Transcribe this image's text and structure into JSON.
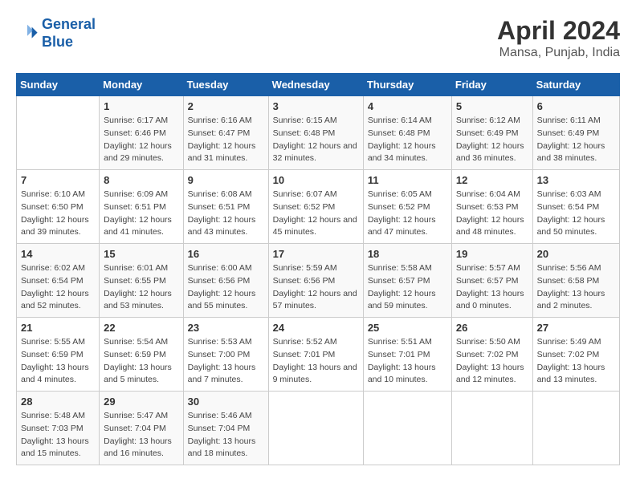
{
  "logo": {
    "line1": "General",
    "line2": "Blue"
  },
  "title": "April 2024",
  "subtitle": "Mansa, Punjab, India",
  "headers": [
    "Sunday",
    "Monday",
    "Tuesday",
    "Wednesday",
    "Thursday",
    "Friday",
    "Saturday"
  ],
  "weeks": [
    [
      {
        "day": "",
        "sunrise": "",
        "sunset": "",
        "daylight": ""
      },
      {
        "day": "1",
        "sunrise": "Sunrise: 6:17 AM",
        "sunset": "Sunset: 6:46 PM",
        "daylight": "Daylight: 12 hours and 29 minutes."
      },
      {
        "day": "2",
        "sunrise": "Sunrise: 6:16 AM",
        "sunset": "Sunset: 6:47 PM",
        "daylight": "Daylight: 12 hours and 31 minutes."
      },
      {
        "day": "3",
        "sunrise": "Sunrise: 6:15 AM",
        "sunset": "Sunset: 6:48 PM",
        "daylight": "Daylight: 12 hours and 32 minutes."
      },
      {
        "day": "4",
        "sunrise": "Sunrise: 6:14 AM",
        "sunset": "Sunset: 6:48 PM",
        "daylight": "Daylight: 12 hours and 34 minutes."
      },
      {
        "day": "5",
        "sunrise": "Sunrise: 6:12 AM",
        "sunset": "Sunset: 6:49 PM",
        "daylight": "Daylight: 12 hours and 36 minutes."
      },
      {
        "day": "6",
        "sunrise": "Sunrise: 6:11 AM",
        "sunset": "Sunset: 6:49 PM",
        "daylight": "Daylight: 12 hours and 38 minutes."
      }
    ],
    [
      {
        "day": "7",
        "sunrise": "Sunrise: 6:10 AM",
        "sunset": "Sunset: 6:50 PM",
        "daylight": "Daylight: 12 hours and 39 minutes."
      },
      {
        "day": "8",
        "sunrise": "Sunrise: 6:09 AM",
        "sunset": "Sunset: 6:51 PM",
        "daylight": "Daylight: 12 hours and 41 minutes."
      },
      {
        "day": "9",
        "sunrise": "Sunrise: 6:08 AM",
        "sunset": "Sunset: 6:51 PM",
        "daylight": "Daylight: 12 hours and 43 minutes."
      },
      {
        "day": "10",
        "sunrise": "Sunrise: 6:07 AM",
        "sunset": "Sunset: 6:52 PM",
        "daylight": "Daylight: 12 hours and 45 minutes."
      },
      {
        "day": "11",
        "sunrise": "Sunrise: 6:05 AM",
        "sunset": "Sunset: 6:52 PM",
        "daylight": "Daylight: 12 hours and 47 minutes."
      },
      {
        "day": "12",
        "sunrise": "Sunrise: 6:04 AM",
        "sunset": "Sunset: 6:53 PM",
        "daylight": "Daylight: 12 hours and 48 minutes."
      },
      {
        "day": "13",
        "sunrise": "Sunrise: 6:03 AM",
        "sunset": "Sunset: 6:54 PM",
        "daylight": "Daylight: 12 hours and 50 minutes."
      }
    ],
    [
      {
        "day": "14",
        "sunrise": "Sunrise: 6:02 AM",
        "sunset": "Sunset: 6:54 PM",
        "daylight": "Daylight: 12 hours and 52 minutes."
      },
      {
        "day": "15",
        "sunrise": "Sunrise: 6:01 AM",
        "sunset": "Sunset: 6:55 PM",
        "daylight": "Daylight: 12 hours and 53 minutes."
      },
      {
        "day": "16",
        "sunrise": "Sunrise: 6:00 AM",
        "sunset": "Sunset: 6:56 PM",
        "daylight": "Daylight: 12 hours and 55 minutes."
      },
      {
        "day": "17",
        "sunrise": "Sunrise: 5:59 AM",
        "sunset": "Sunset: 6:56 PM",
        "daylight": "Daylight: 12 hours and 57 minutes."
      },
      {
        "day": "18",
        "sunrise": "Sunrise: 5:58 AM",
        "sunset": "Sunset: 6:57 PM",
        "daylight": "Daylight: 12 hours and 59 minutes."
      },
      {
        "day": "19",
        "sunrise": "Sunrise: 5:57 AM",
        "sunset": "Sunset: 6:57 PM",
        "daylight": "Daylight: 13 hours and 0 minutes."
      },
      {
        "day": "20",
        "sunrise": "Sunrise: 5:56 AM",
        "sunset": "Sunset: 6:58 PM",
        "daylight": "Daylight: 13 hours and 2 minutes."
      }
    ],
    [
      {
        "day": "21",
        "sunrise": "Sunrise: 5:55 AM",
        "sunset": "Sunset: 6:59 PM",
        "daylight": "Daylight: 13 hours and 4 minutes."
      },
      {
        "day": "22",
        "sunrise": "Sunrise: 5:54 AM",
        "sunset": "Sunset: 6:59 PM",
        "daylight": "Daylight: 13 hours and 5 minutes."
      },
      {
        "day": "23",
        "sunrise": "Sunrise: 5:53 AM",
        "sunset": "Sunset: 7:00 PM",
        "daylight": "Daylight: 13 hours and 7 minutes."
      },
      {
        "day": "24",
        "sunrise": "Sunrise: 5:52 AM",
        "sunset": "Sunset: 7:01 PM",
        "daylight": "Daylight: 13 hours and 9 minutes."
      },
      {
        "day": "25",
        "sunrise": "Sunrise: 5:51 AM",
        "sunset": "Sunset: 7:01 PM",
        "daylight": "Daylight: 13 hours and 10 minutes."
      },
      {
        "day": "26",
        "sunrise": "Sunrise: 5:50 AM",
        "sunset": "Sunset: 7:02 PM",
        "daylight": "Daylight: 13 hours and 12 minutes."
      },
      {
        "day": "27",
        "sunrise": "Sunrise: 5:49 AM",
        "sunset": "Sunset: 7:02 PM",
        "daylight": "Daylight: 13 hours and 13 minutes."
      }
    ],
    [
      {
        "day": "28",
        "sunrise": "Sunrise: 5:48 AM",
        "sunset": "Sunset: 7:03 PM",
        "daylight": "Daylight: 13 hours and 15 minutes."
      },
      {
        "day": "29",
        "sunrise": "Sunrise: 5:47 AM",
        "sunset": "Sunset: 7:04 PM",
        "daylight": "Daylight: 13 hours and 16 minutes."
      },
      {
        "day": "30",
        "sunrise": "Sunrise: 5:46 AM",
        "sunset": "Sunset: 7:04 PM",
        "daylight": "Daylight: 13 hours and 18 minutes."
      },
      {
        "day": "",
        "sunrise": "",
        "sunset": "",
        "daylight": ""
      },
      {
        "day": "",
        "sunrise": "",
        "sunset": "",
        "daylight": ""
      },
      {
        "day": "",
        "sunrise": "",
        "sunset": "",
        "daylight": ""
      },
      {
        "day": "",
        "sunrise": "",
        "sunset": "",
        "daylight": ""
      }
    ]
  ]
}
